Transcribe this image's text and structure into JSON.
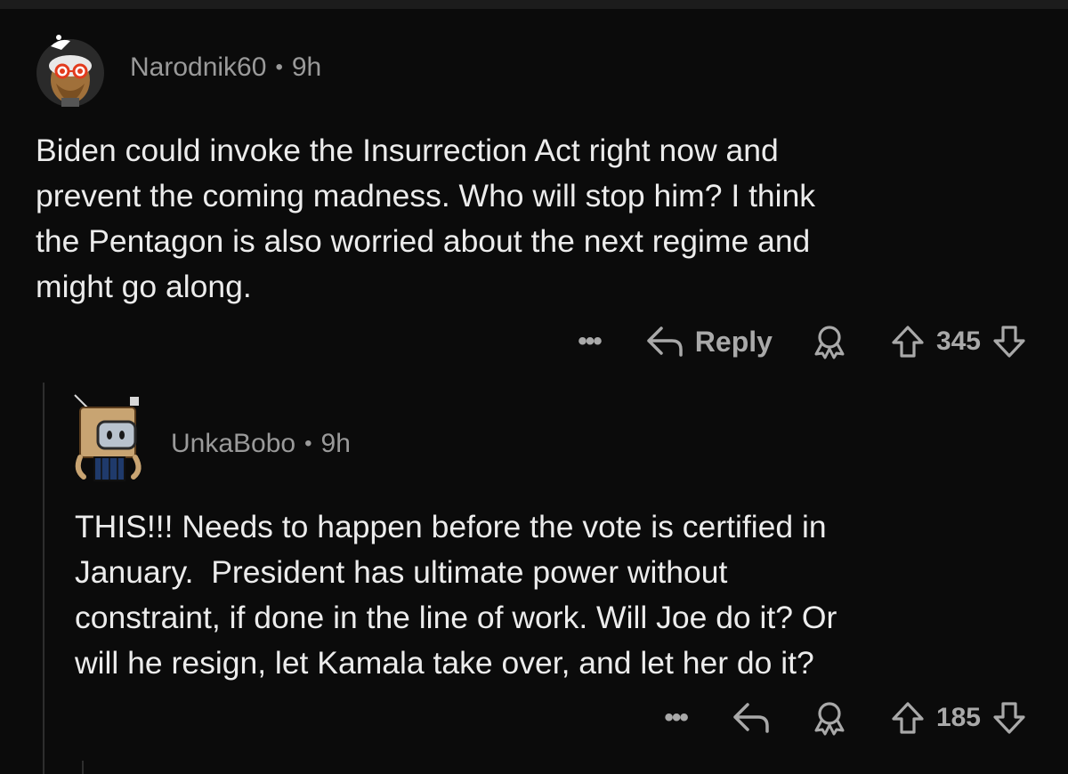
{
  "comments": [
    {
      "username": "Narodnik60",
      "separator": "•",
      "age": "9h",
      "text": "Biden could invoke the Insurrection Act right now and\nprevent the coming madness. Who will stop him? I think\nthe Pentagon is also worried about the next regime and\nmight go along.",
      "actions": {
        "more_label": "•••",
        "reply_label": "Reply",
        "vote_count": "345"
      }
    },
    {
      "username": "UnkaBobo",
      "separator": "•",
      "age": "9h",
      "text": "THIS!!! Needs to happen before the vote is certified in\nJanuary.  President has ultimate power without\nconstraint, if done in the line of work. Will Joe do it? Or\nwill he resign, let Kamala take over, and let her do it?",
      "actions": {
        "more_label": "•••",
        "vote_count": "185"
      }
    }
  ],
  "icons": {
    "reply": "reply-arrow-icon",
    "award": "award-icon",
    "upvote": "upvote-arrow-icon",
    "downvote": "downvote-arrow-icon"
  },
  "colors": {
    "background": "#0b0b0b",
    "text": "#ececec",
    "meta": "#9a9a9a",
    "actions": "#a9a9a9"
  }
}
